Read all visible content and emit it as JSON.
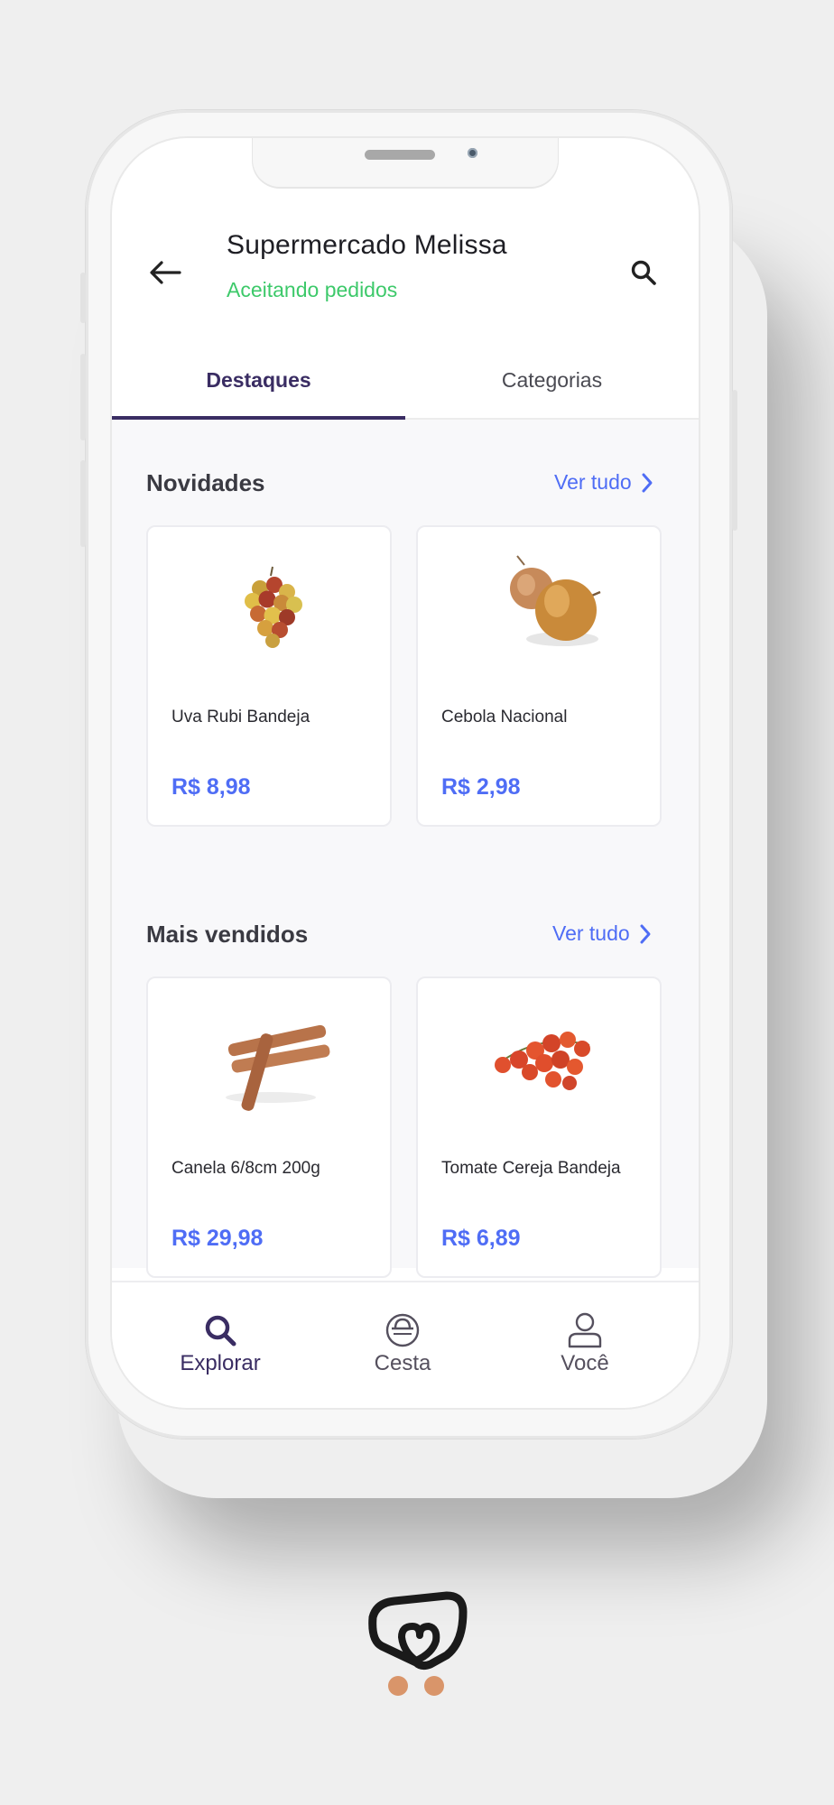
{
  "header": {
    "store_name": "Supermercado Melissa",
    "status": "Aceitando pedidos",
    "status_color": "#3dc96a",
    "back_icon": "arrow-left-icon",
    "search_icon": "search-icon"
  },
  "tabs": [
    {
      "label": "Destaques",
      "active": true
    },
    {
      "label": "Categorias",
      "active": false
    }
  ],
  "sections": [
    {
      "title": "Novidades",
      "see_all": "Ver tudo",
      "products": [
        {
          "name": "Uva Rubi Bandeja",
          "price": "R$ 8,98",
          "image": "grapes"
        },
        {
          "name": "Cebola Nacional",
          "price": "R$ 2,98",
          "image": "onions"
        }
      ]
    },
    {
      "title": "Mais vendidos",
      "see_all": "Ver tudo",
      "products": [
        {
          "name": "Canela 6/8cm 200g",
          "price": "R$ 29,98",
          "image": "cinnamon"
        },
        {
          "name": "Tomate Cereja Bandeja",
          "price": "R$ 6,89",
          "image": "cherry-tomatoes"
        }
      ]
    }
  ],
  "bottom_nav": [
    {
      "label": "Explorar",
      "icon": "search-icon",
      "active": true
    },
    {
      "label": "Cesta",
      "icon": "basket-icon",
      "active": false
    },
    {
      "label": "Você",
      "icon": "user-icon",
      "active": false
    }
  ],
  "colors": {
    "accent": "#4f6df5",
    "primary_dark": "#3a2d63",
    "brand_dots": "#d9956a"
  }
}
